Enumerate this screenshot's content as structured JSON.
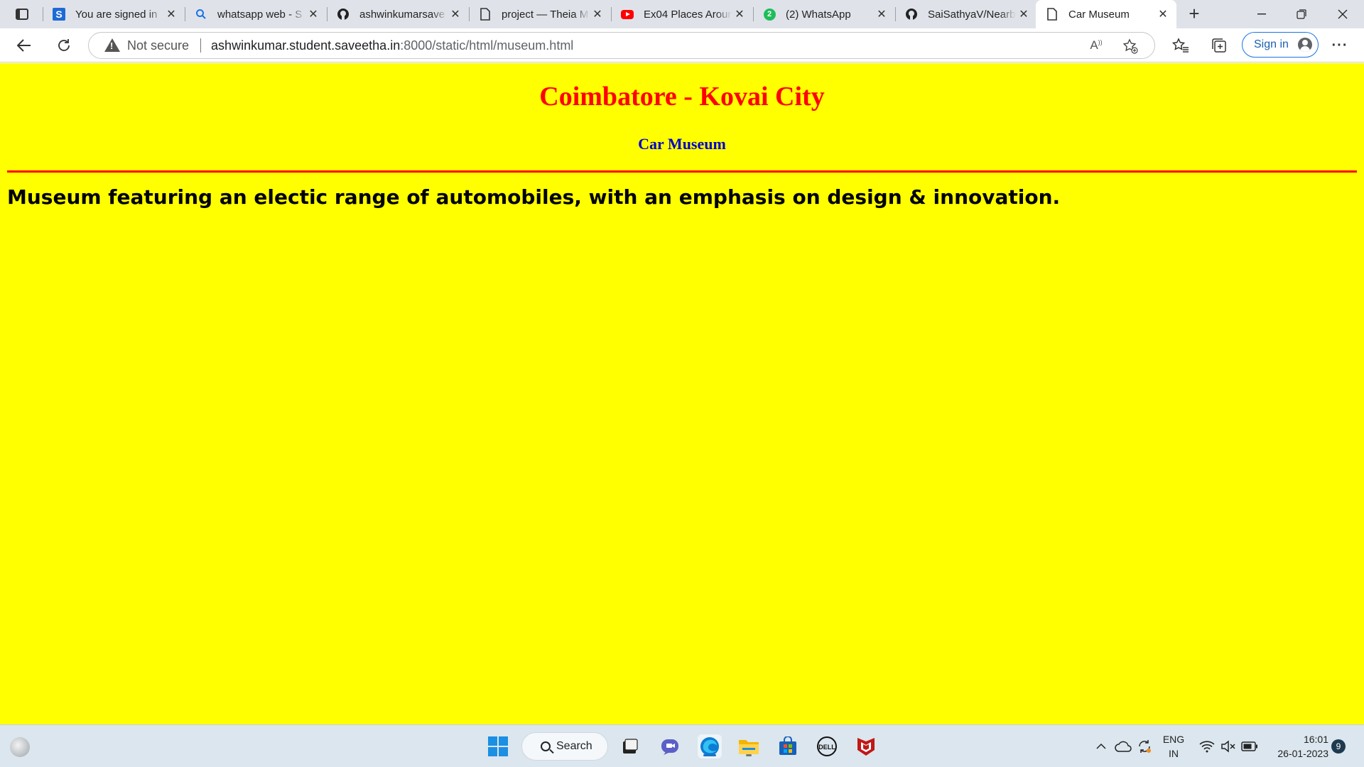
{
  "browser": {
    "tabs": [
      {
        "title": "You are signed in",
        "favicon": "s-logo-icon"
      },
      {
        "title": "whatsapp web - S",
        "favicon": "search-icon"
      },
      {
        "title": "ashwinkumarsave",
        "favicon": "github-icon"
      },
      {
        "title": "project — Theia M",
        "favicon": "page-icon"
      },
      {
        "title": "Ex04 Places Arour",
        "favicon": "youtube-icon"
      },
      {
        "title": "(2) WhatsApp",
        "favicon": "whatsapp-icon",
        "badge": "2"
      },
      {
        "title": "SaiSathyaV/Nearb",
        "favicon": "github-icon"
      },
      {
        "title": "Car Museum",
        "favicon": "page-icon",
        "active": true
      }
    ],
    "address": {
      "security_label": "Not secure",
      "host": "ashwinkumar.student.saveetha.in",
      "path": ":8000/static/html/museum.html"
    },
    "signin_label": "Sign in"
  },
  "page": {
    "background": "#ffff00",
    "heading": "Coimbatore - Kovai City",
    "heading_color": "#ff0000",
    "subheading": "Car Museum",
    "subheading_color": "#0000cc",
    "rule_color": "#ff0000",
    "description": "Museum featuring an electic range of automobiles, with an emphasis on design & innovation."
  },
  "taskbar": {
    "search_label": "Search",
    "lang_line1": "ENG",
    "lang_line2": "IN",
    "time": "16:01",
    "date": "26-01-2023",
    "notification_count": "9"
  }
}
